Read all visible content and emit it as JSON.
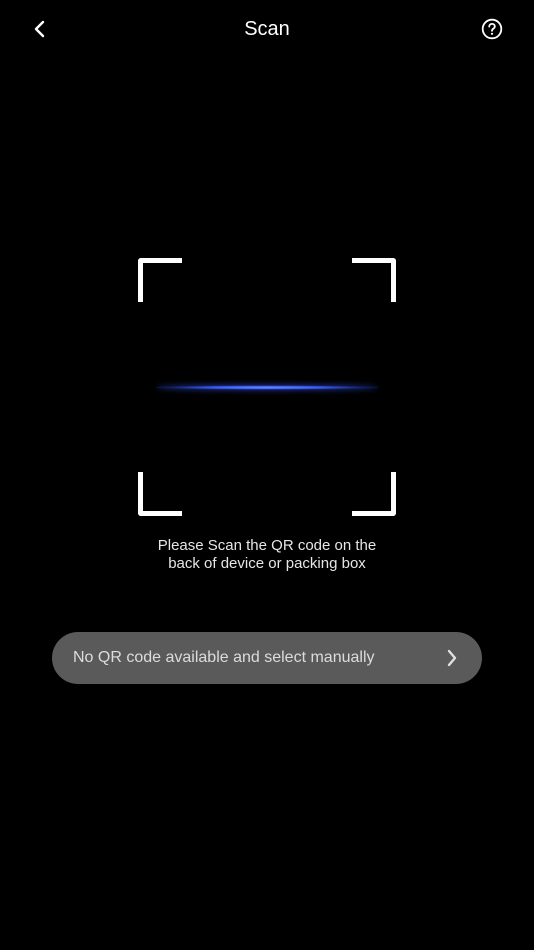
{
  "header": {
    "title": "Scan",
    "back_icon": "chevron-left-icon",
    "help_icon": "question-circle-icon"
  },
  "scanner": {
    "frame_color": "#ffffff",
    "scan_line_color": "#3a5cf5",
    "instruction_line1": "Please Scan the QR code on the",
    "instruction_line2": "back of device or packing box"
  },
  "manual_select": {
    "label": "No QR code available and select manually",
    "icon": "chevron-right-icon",
    "background": "#5a5a5a"
  },
  "colors": {
    "background": "#000000",
    "accent": "#3a5cf5"
  }
}
